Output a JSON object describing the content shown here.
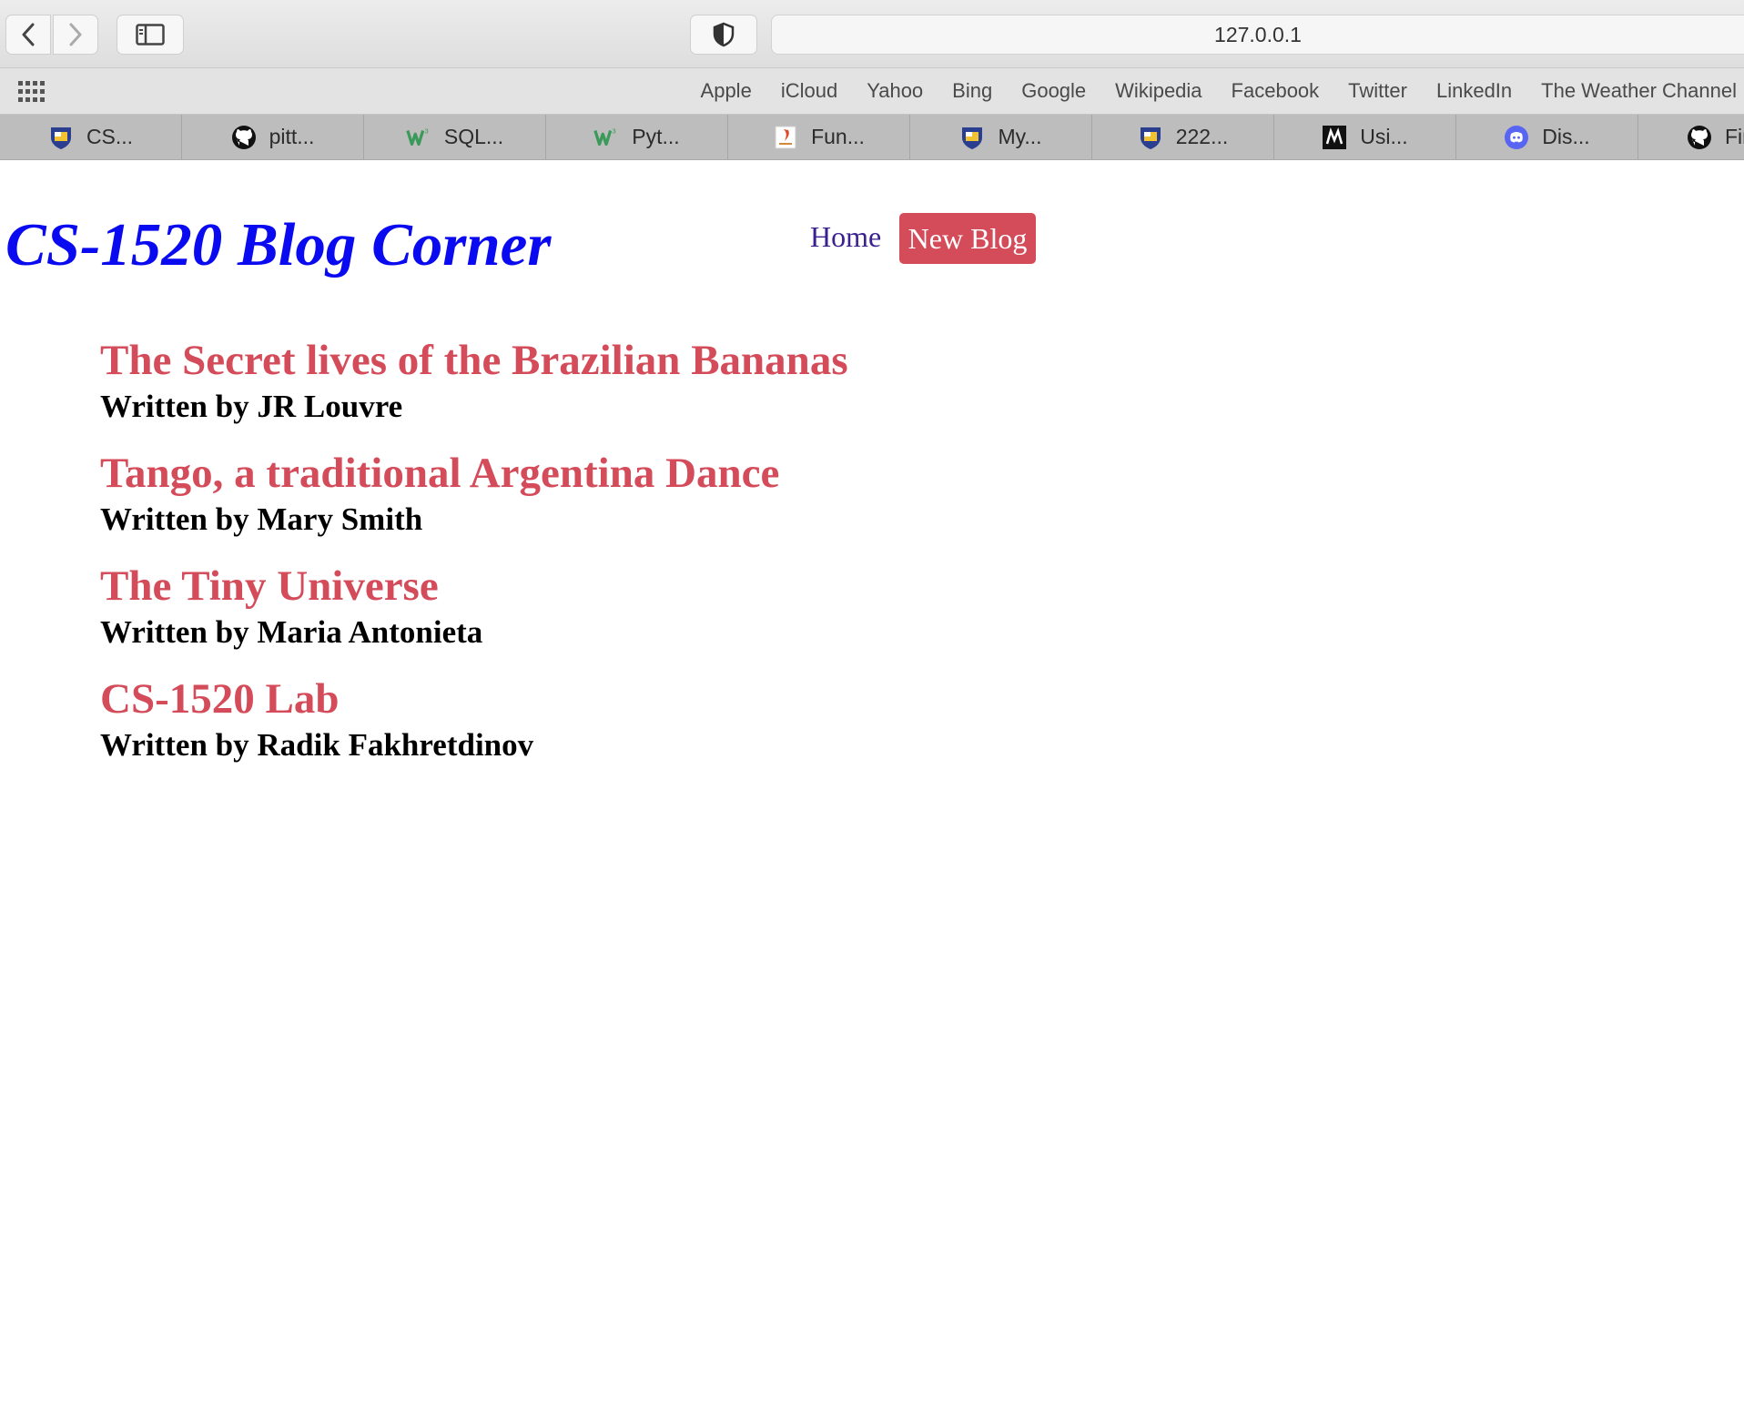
{
  "browser": {
    "url": "127.0.0.1",
    "favorites": [
      "Apple",
      "iCloud",
      "Yahoo",
      "Bing",
      "Google",
      "Wikipedia",
      "Facebook",
      "Twitter",
      "LinkedIn",
      "The Weather Channel"
    ],
    "tabs": [
      {
        "label": "CS...",
        "icon": "pitt-shield-icon"
      },
      {
        "label": "pitt...",
        "icon": "github-icon"
      },
      {
        "label": "SQL...",
        "icon": "w3schools-icon"
      },
      {
        "label": "Pyt...",
        "icon": "w3schools-icon"
      },
      {
        "label": "Fun...",
        "icon": "doc-icon"
      },
      {
        "label": "My...",
        "icon": "pitt-shield-icon"
      },
      {
        "label": "222...",
        "icon": "pitt-shield-icon"
      },
      {
        "label": "Usi...",
        "icon": "m-logo-icon"
      },
      {
        "label": "Dis...",
        "icon": "discord-icon"
      },
      {
        "label": "Fin...",
        "icon": "github-icon"
      }
    ]
  },
  "site": {
    "title": "CS-1520 Blog Corner",
    "nav": {
      "home": "Home",
      "new_blog": "New Blog"
    }
  },
  "posts": [
    {
      "title": "The Secret lives of the Brazilian Bananas",
      "author": "Written by JR Louvre"
    },
    {
      "title": "Tango, a traditional Argentina Dance",
      "author": "Written by Mary Smith"
    },
    {
      "title": "The Tiny Universe",
      "author": "Written by Maria Antonieta"
    },
    {
      "title": "CS-1520 Lab",
      "author": "Written by Radik Fakhretdinov"
    }
  ],
  "colors": {
    "title_blue": "#0a0af0",
    "accent_red": "#d44b5a",
    "home_link": "#3a2090"
  }
}
